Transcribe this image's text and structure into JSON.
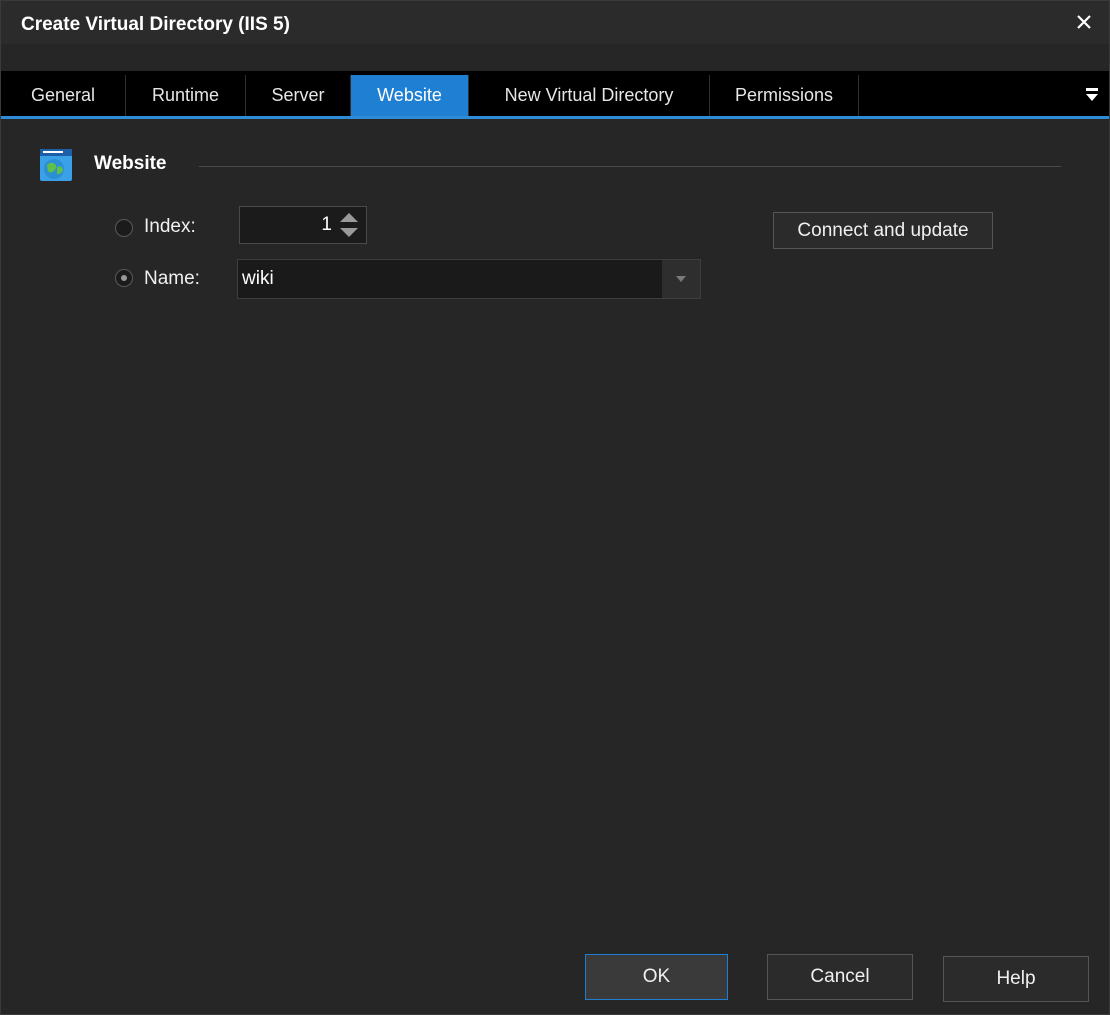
{
  "window": {
    "title": "Create Virtual Directory (IIS 5)"
  },
  "tabs": [
    {
      "label": "General"
    },
    {
      "label": "Runtime"
    },
    {
      "label": "Server"
    },
    {
      "label": "Website",
      "active": true
    },
    {
      "label": "New Virtual Directory"
    },
    {
      "label": "Permissions"
    }
  ],
  "group": {
    "title": "Website",
    "icon": "website-globe-icon"
  },
  "index": {
    "label": "Index:",
    "value": "1",
    "selected": false
  },
  "name": {
    "label": "Name:",
    "value": "wiki",
    "selected": true
  },
  "connect_button": "Connect and update",
  "footer": {
    "ok": "OK",
    "cancel": "Cancel",
    "help": "Help"
  },
  "colors": {
    "accent": "#1f7fd2",
    "background": "#262626",
    "tabbar": "#000000"
  }
}
